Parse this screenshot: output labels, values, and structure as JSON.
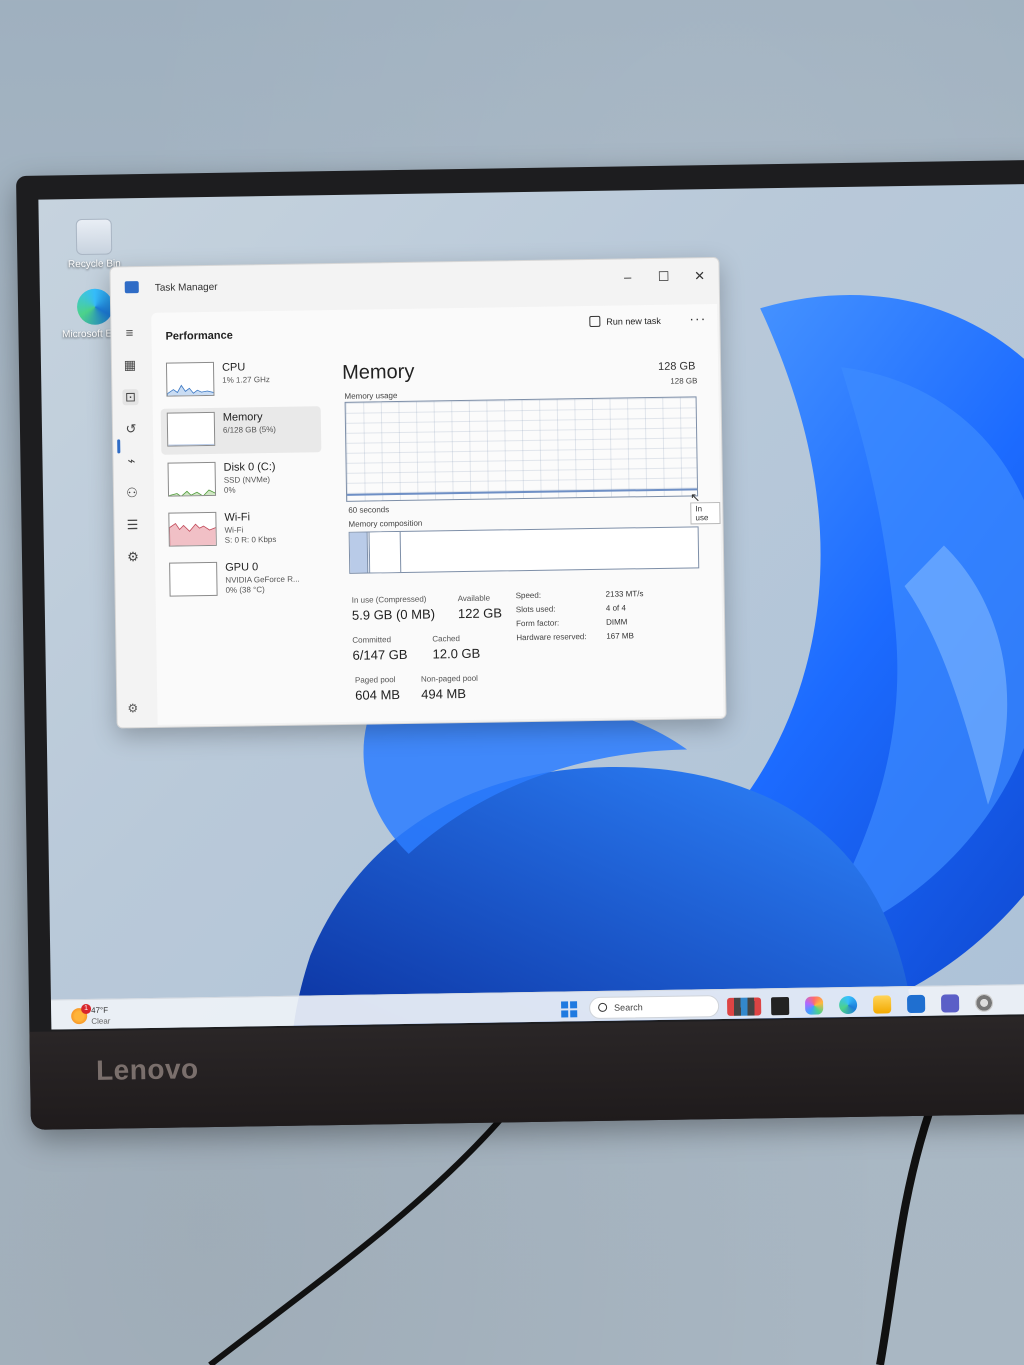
{
  "desktop": {
    "icons": [
      {
        "label": "Recycle Bin"
      },
      {
        "label": "Microsoft Edge"
      }
    ]
  },
  "monitor": {
    "brand": "Lenovo"
  },
  "task_manager": {
    "window_title": "Task Manager",
    "page_title": "Performance",
    "run_new_task": "Run new task",
    "more": "···",
    "window_controls": {
      "minimize": "–",
      "maximize": "☐",
      "close": "✕"
    },
    "sidebar": [
      {
        "name": "CPU",
        "line1": "1% 1.27 GHz",
        "line2": ""
      },
      {
        "name": "Memory",
        "line1": "6/128 GB (5%)",
        "line2": ""
      },
      {
        "name": "Disk 0 (C:)",
        "line1": "SSD (NVMe)",
        "line2": "0%"
      },
      {
        "name": "Wi-Fi",
        "line1": "Wi-Fi",
        "line2": "S: 0 R: 0 Kbps"
      },
      {
        "name": "GPU 0",
        "line1": "NVIDIA GeForce R...",
        "line2": "0% (38 °C)"
      }
    ],
    "memory": {
      "title": "Memory",
      "total": "128 GB",
      "usage_label": "Memory usage",
      "usage_max": "128 GB",
      "time_span": "60 seconds",
      "tooltip": "In use",
      "composition_label": "Memory composition",
      "composition": {
        "in_use_fraction": 0.05,
        "modified_fraction": 0.004,
        "standby_fraction": 0.09
      },
      "stats": {
        "in_use_label": "In use (Compressed)",
        "in_use_value": "5.9 GB (0 MB)",
        "available_label": "Available",
        "available_value": "122 GB",
        "committed_label": "Committed",
        "committed_value": "6/147 GB",
        "cached_label": "Cached",
        "cached_value": "12.0 GB",
        "paged_label": "Paged pool",
        "paged_value": "604 MB",
        "nonpaged_label": "Non-paged pool",
        "nonpaged_value": "494 MB"
      },
      "specs": [
        {
          "label": "Speed:",
          "value": "2133 MT/s"
        },
        {
          "label": "Slots used:",
          "value": "4 of 4"
        },
        {
          "label": "Form factor:",
          "value": "DIMM"
        },
        {
          "label": "Hardware reserved:",
          "value": "167 MB"
        }
      ]
    }
  },
  "taskbar": {
    "weather_temp": "47°F",
    "weather_desc": "Clear",
    "weather_badge": "1",
    "search_placeholder": "Search"
  },
  "colors": {
    "accent": "#2f6cc6",
    "in_use_fill": "#b9cbe8",
    "wallpaper_blue": "#1c6bff"
  }
}
